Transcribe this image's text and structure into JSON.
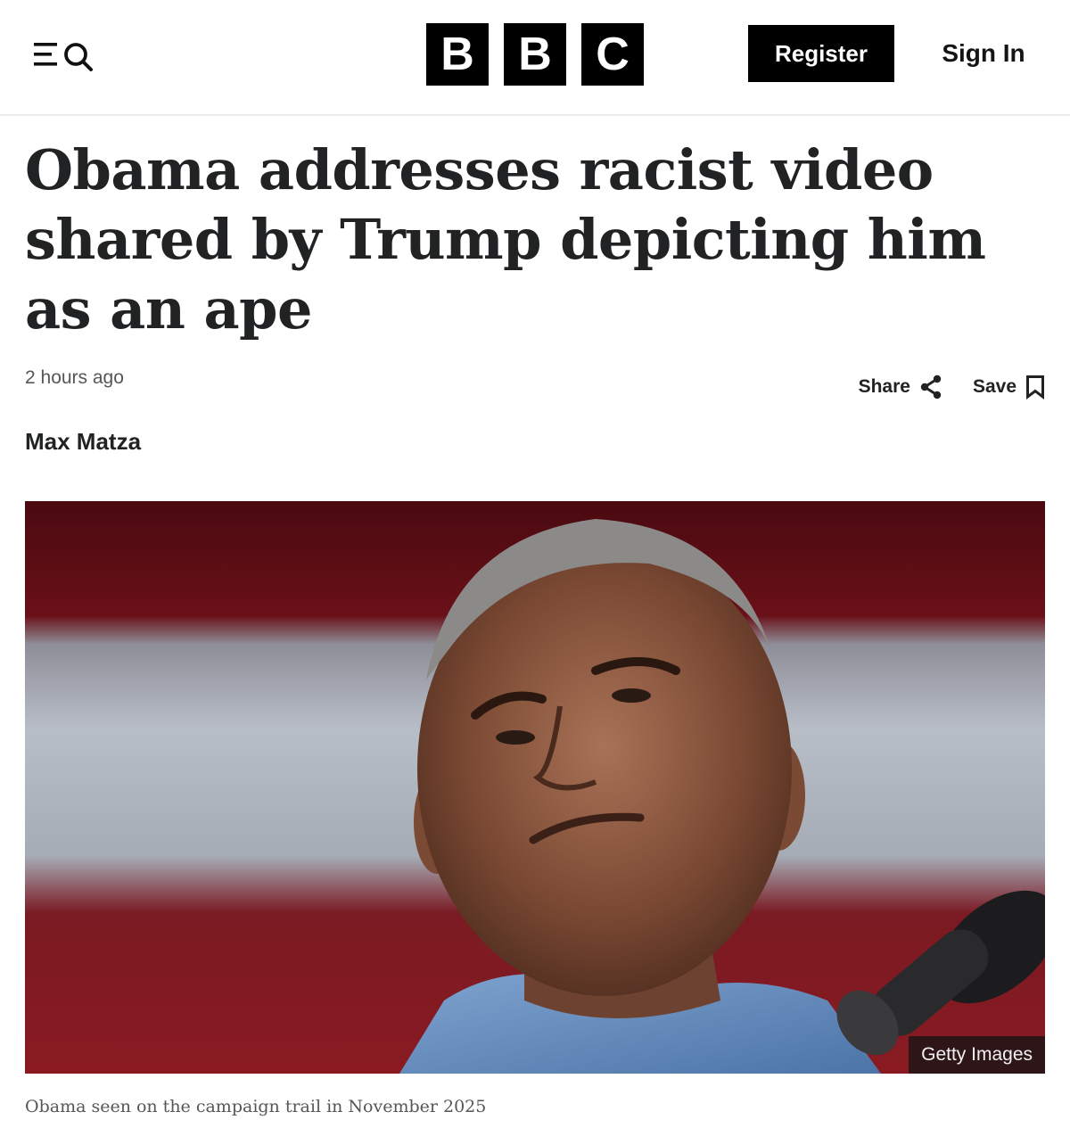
{
  "header": {
    "logo_letters": [
      "B",
      "B",
      "C"
    ],
    "register_label": "Register",
    "signin_label": "Sign In",
    "menu_icon": "menu-icon",
    "search_icon": "search-icon"
  },
  "article": {
    "headline": "Obama addresses racist video shared by Trump depicting him as an ape",
    "timestamp": "2 hours ago",
    "share_label": "Share",
    "save_label": "Save",
    "share_icon": "share-icon",
    "save_icon": "bookmark-icon",
    "byline": "Max Matza"
  },
  "image": {
    "credit": "Getty Images",
    "caption": "Obama seen on the campaign trail in November 2025"
  },
  "colors": {
    "brand_black": "#000000",
    "text": "#202224",
    "muted": "#545658"
  }
}
